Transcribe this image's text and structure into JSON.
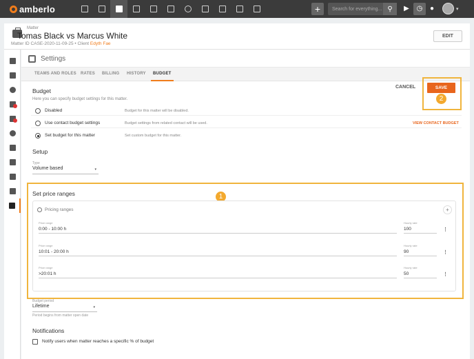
{
  "topbar": {
    "brand": "amberlo",
    "nav_icons": [
      "dashboard-icon",
      "contacts-icon",
      "matters-icon",
      "documents-icon",
      "bank-icon",
      "calendar-icon",
      "time-icon",
      "folder-icon",
      "invoice-icon",
      "mail-icon",
      "reports-icon"
    ],
    "active_nav": "matters-icon",
    "add_label": "+",
    "search_placeholder": "Search for everything...",
    "play_glyph": "▶",
    "timer_glyph": "◷",
    "bell_glyph": "🔔",
    "caret_glyph": "▾"
  },
  "header": {
    "label": "Matter",
    "title": "Tomas Black vs Marcus White",
    "matter_id_label": "Matter ID",
    "matter_id": "CASE-2020-11-09-25",
    "separator": "•",
    "client_label": "Client",
    "client_name": "Edyth Fae",
    "edit_label": "EDIT"
  },
  "sidebar": {
    "icons": [
      "book-icon",
      "people-icon",
      "share-icon",
      "tasks-icon",
      "calendar-badge-icon",
      "timer-money-icon",
      "transfer-icon",
      "invoice-icon",
      "device-icon",
      "mail-icon",
      "settings-icon"
    ],
    "active_index": 10
  },
  "settings": {
    "title": "Settings",
    "tabs": [
      "TEAMS AND ROLES",
      "RATES",
      "BILLING",
      "HISTORY",
      "BUDGET"
    ],
    "active_tab": "BUDGET"
  },
  "budget": {
    "title": "Budget",
    "subtitle": "Here you can specify budget settings for this matter.",
    "cancel_label": "CANCEL",
    "save_label": "SAVE",
    "options": [
      {
        "label": "Disabled",
        "description": "Budget for this matter will be disabled.",
        "selected": false,
        "link": ""
      },
      {
        "label": "Use contact budget settings",
        "description": "Budget settings from related contact will be used.",
        "selected": false,
        "link": "VIEW CONTACT BUDGET"
      },
      {
        "label": "Set budget for this matter",
        "description": "Set custom budget for this matter.",
        "selected": true,
        "link": ""
      }
    ]
  },
  "setup": {
    "title": "Setup",
    "type_label": "Type",
    "type_value": "Volume based",
    "arrow": "▾"
  },
  "price_ranges": {
    "title": "Set price ranges",
    "card_title": "Pricing ranges",
    "add_label": "+",
    "range_label": "Price range",
    "rate_label": "Hourly rate",
    "rows": [
      {
        "range": "0:00 - 10:00 h",
        "rate": "100"
      },
      {
        "range": "10:01 - 20:00 h",
        "rate": "90"
      },
      {
        "range": ">20:01 h",
        "rate": "50"
      }
    ],
    "kebab": "⋮"
  },
  "period": {
    "label": "Budget period",
    "value": "Lifetime",
    "helper": "Period begins from matter open date",
    "arrow": "▾"
  },
  "notifications": {
    "title": "Notifications",
    "checkbox_label": "Notify users when matter reaches a specific % of budget"
  },
  "annotations": {
    "badge1": "1",
    "badge2": "2",
    "highlight_color": "#f0b43c"
  },
  "colors": {
    "accent": "#e8651c",
    "topbar": "#3b3b3b"
  }
}
